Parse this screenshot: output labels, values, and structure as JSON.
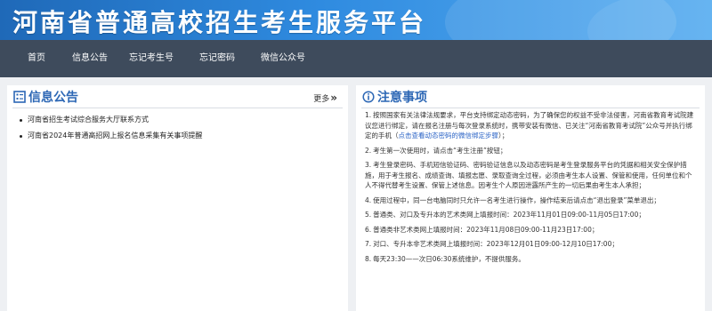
{
  "site": {
    "title": "河南省普通高校招生考生服务平台"
  },
  "nav": {
    "items": [
      {
        "label": "首页"
      },
      {
        "label": "信息公告"
      },
      {
        "label": "忘记考生号"
      },
      {
        "label": "忘记密码"
      },
      {
        "label": "微信公众号"
      }
    ]
  },
  "info": {
    "title": "信息公告",
    "more": "更多",
    "items": [
      "河南省招生考试综合服务大厅联系方式",
      "河南省2024年普通高招网上报名信息采集有关事项提醒"
    ]
  },
  "notice": {
    "title": "注意事项",
    "items": [
      {
        "num": "1.",
        "text": "按照国家有关法律法规要求，平台支持绑定动态密码，为了确保您的权益不受非法侵害，河南省教育考试院建议您进行绑定，请在报名注册与每次登录系统时，携带安装有微信、已关注“河南省教育考试院”公众号并执行绑定的手机（",
        "link": "点击查看动态密码的微信绑定步骤",
        "tail": "）；"
      },
      {
        "num": "2.",
        "text": "考生第一次使用时，请点击“考生注册”按钮；"
      },
      {
        "num": "3.",
        "text": "考生登录密码、手机短信验证码、密码验证信息以及动态密码是考生登录服务平台的凭据和相关安全保护措施，用于考生报名、成绩查询、填报志愿、录取查询全过程，必须由考生本人设置、保管和使用，任何单位和个人不得代替考生设置、保管上述信息。因考生个人原因泄露所产生的一切后果由考生本人承担；"
      },
      {
        "num": "4.",
        "text": "使用过程中，同一台电脑同时只允许一名考生进行操作，操作结束后请点击“退出登录”菜单退出；"
      },
      {
        "num": "5.",
        "text": "普通类、对口及专升本的艺术类网上填报时间：2023年11月01日09:00-11月05日17:00；"
      },
      {
        "num": "6.",
        "text": "普通类非艺术类网上填报时间：2023年11月08日09:00-11月23日17:00；"
      },
      {
        "num": "7.",
        "text": "对口、专升本非艺术类网上填报时间：2023年12月01日09:00-12月10日17:00；"
      },
      {
        "num": "8.",
        "text": "每天23:30——次日06:30系统维护，不提供服务。"
      }
    ]
  },
  "colors": {
    "header": "#2f8be0",
    "nav": "#3e4b5c",
    "accent": "#2c67b5",
    "link": "#2a63c6"
  },
  "icons": {
    "info": "document-list-icon",
    "notice": "info-circle-icon",
    "more": "double-chevron-right-icon"
  }
}
